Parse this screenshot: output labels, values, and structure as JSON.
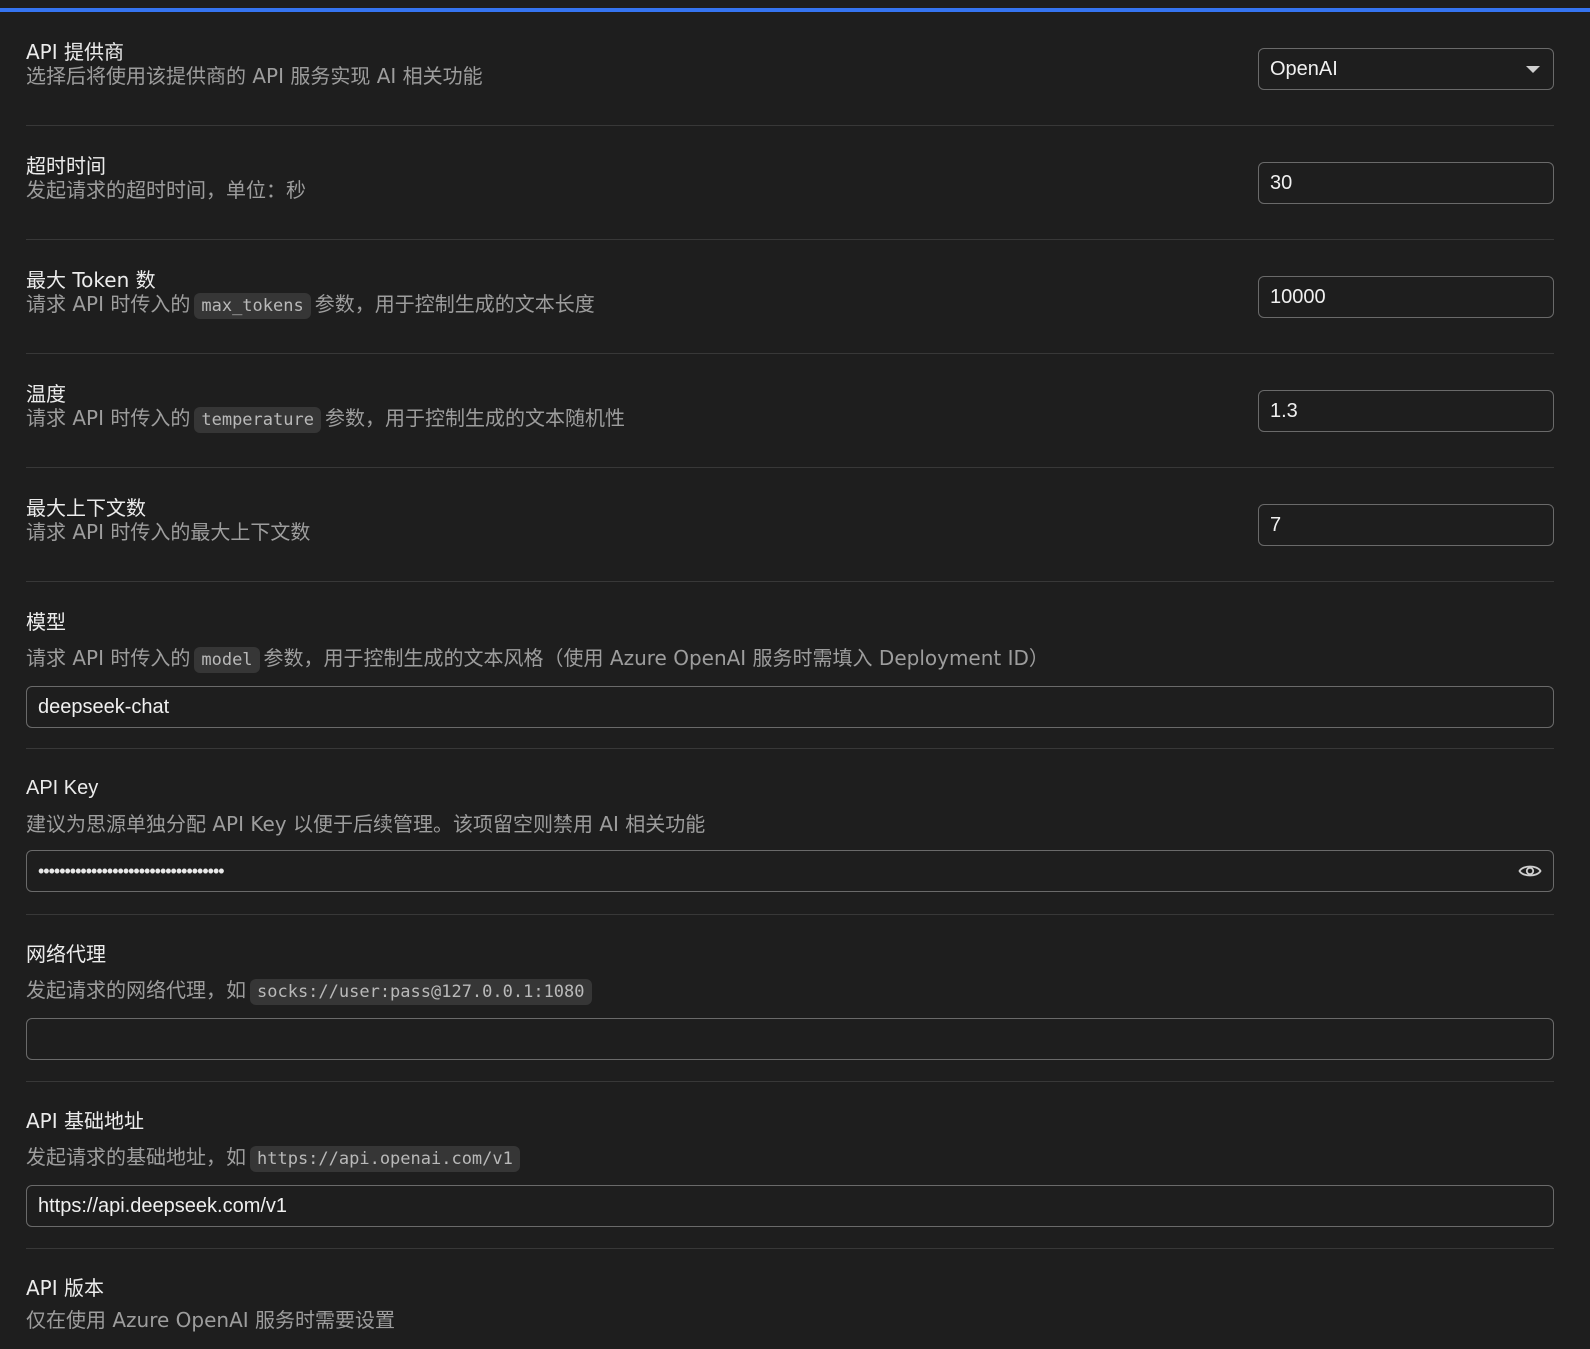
{
  "colors": {
    "accent": "#3574f0",
    "background": "#1e1e1e"
  },
  "settings": {
    "provider": {
      "title": "API 提供商",
      "desc": "选择后将使用该提供商的 API 服务实现 AI 相关功能",
      "value": "OpenAI"
    },
    "timeout": {
      "title": "超时时间",
      "desc": "发起请求的超时时间，单位：秒",
      "value": "30"
    },
    "max_tokens": {
      "title": "最大 Token 数",
      "desc_prefix": "请求 API 时传入的",
      "desc_code": "max_tokens",
      "desc_suffix": "参数，用于控制生成的文本长度",
      "value": "10000"
    },
    "temperature": {
      "title": "温度",
      "desc_prefix": "请求 API 时传入的",
      "desc_code": "temperature",
      "desc_suffix": "参数，用于控制生成的文本随机性",
      "value": "1.3"
    },
    "max_contexts": {
      "title": "最大上下文数",
      "desc": "请求 API 时传入的最大上下文数",
      "value": "7"
    },
    "model": {
      "title": "模型",
      "desc_prefix": "请求 API 时传入的",
      "desc_code": "model",
      "desc_suffix": "参数，用于控制生成的文本风格（使用 Azure OpenAI 服务时需填入 Deployment ID）",
      "value": "deepseek-chat"
    },
    "api_key": {
      "title": "API Key",
      "desc": "建议为思源单独分配 API Key 以便于后续管理。该项留空则禁用 AI 相关功能",
      "value_masked": "•••••••••••••••••••••••••••••••••••",
      "reveal_icon": "eye-icon"
    },
    "proxy": {
      "title": "网络代理",
      "desc_prefix": "发起请求的网络代理，如",
      "desc_code": "socks://user:pass@127.0.0.1:1080",
      "value": ""
    },
    "base_url": {
      "title": "API 基础地址",
      "desc_prefix": "发起请求的基础地址，如",
      "desc_code": "https://api.openai.com/v1",
      "value": "https://api.deepseek.com/v1"
    },
    "api_version": {
      "title": "API 版本",
      "desc": "仅在使用 Azure OpenAI 服务时需要设置"
    }
  }
}
